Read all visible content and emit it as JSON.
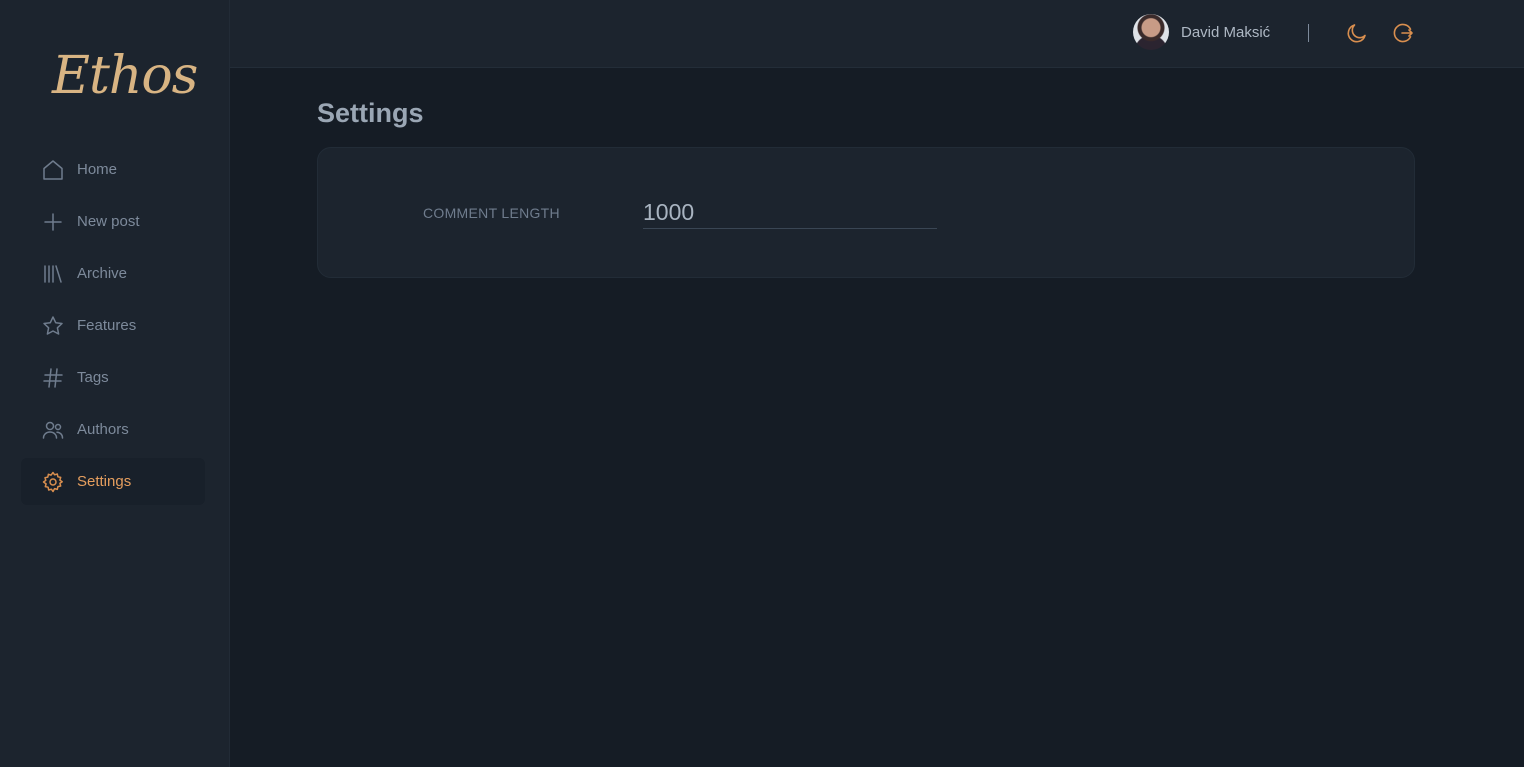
{
  "app": {
    "logo": "Ethos"
  },
  "sidebar": {
    "items": [
      {
        "label": "Home",
        "icon": "home-icon",
        "active": false
      },
      {
        "label": "New post",
        "icon": "plus-icon",
        "active": false
      },
      {
        "label": "Archive",
        "icon": "library-icon",
        "active": false
      },
      {
        "label": "Features",
        "icon": "star-icon",
        "active": false
      },
      {
        "label": "Tags",
        "icon": "hash-icon",
        "active": false
      },
      {
        "label": "Authors",
        "icon": "users-icon",
        "active": false
      },
      {
        "label": "Settings",
        "icon": "gear-icon",
        "active": true
      }
    ]
  },
  "header": {
    "user_name": "David Maksić",
    "icons": [
      "moon-icon",
      "logout-icon"
    ]
  },
  "main": {
    "title": "Settings",
    "settings": {
      "comment_length_label": "COMMENT LENGTH",
      "comment_length_value": "1000"
    }
  },
  "colors": {
    "accent": "#d98f4f",
    "logo": "#d8b483",
    "background": "#151c25",
    "panel": "#1c242e"
  }
}
